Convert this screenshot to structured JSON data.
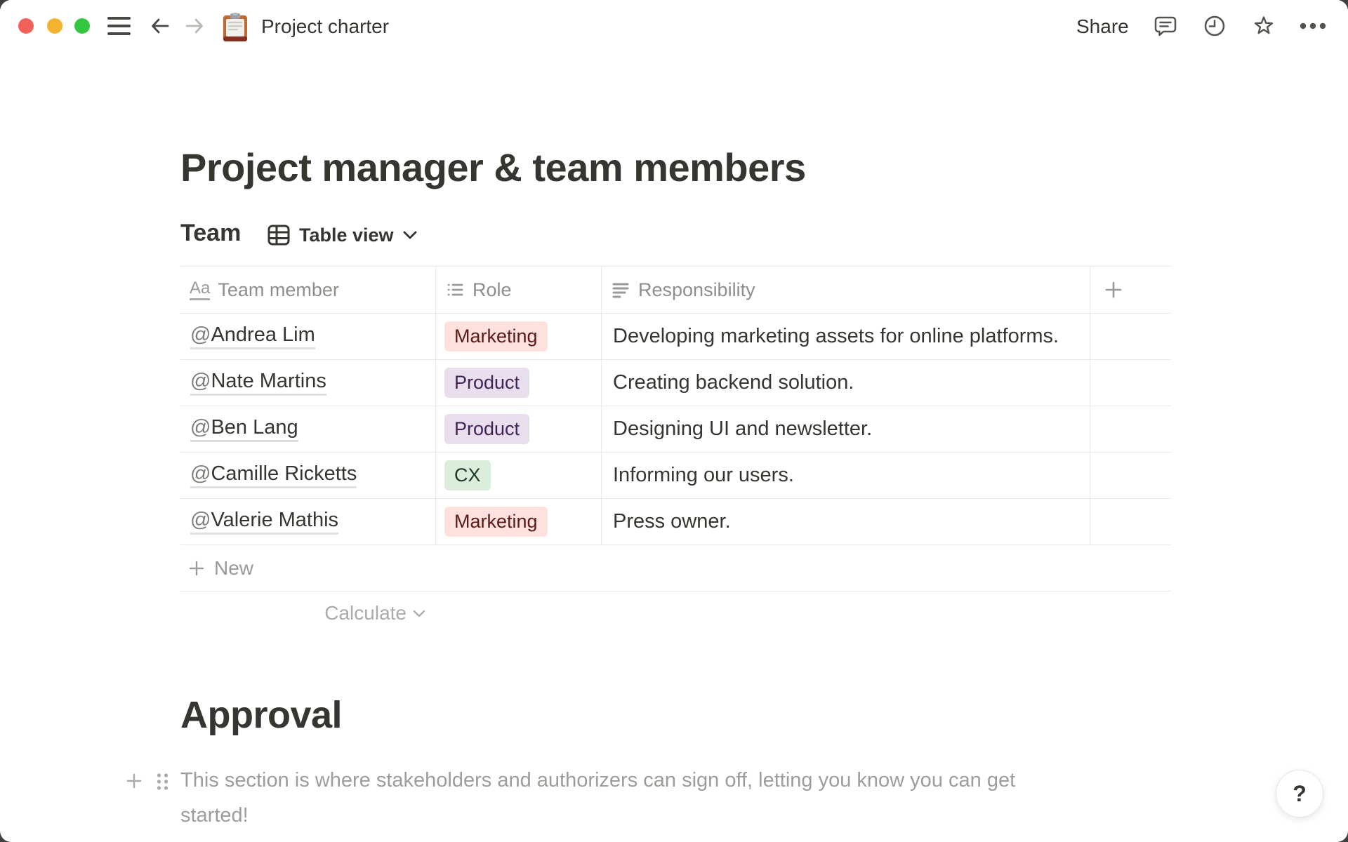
{
  "topbar": {
    "doc_title": "Project charter",
    "share_label": "Share"
  },
  "page": {
    "title": "Project manager & team members"
  },
  "team_section": {
    "heading": "Team",
    "view_label": "Table view",
    "table": {
      "columns": [
        {
          "label": "Team member"
        },
        {
          "label": "Role"
        },
        {
          "label": "Responsibility"
        }
      ],
      "rows": [
        {
          "member": "@Andrea Lim",
          "role": {
            "label": "Marketing",
            "color": "red"
          },
          "responsibility": "Developing marketing assets for online platforms."
        },
        {
          "member": "@Nate Martins",
          "role": {
            "label": "Product",
            "color": "purple"
          },
          "responsibility": "Creating backend solution."
        },
        {
          "member": "@Ben Lang",
          "role": {
            "label": "Product",
            "color": "purple"
          },
          "responsibility": "Designing UI and newsletter."
        },
        {
          "member": "@Camille Ricketts",
          "role": {
            "label": "CX",
            "color": "green"
          },
          "responsibility": "Informing our users."
        },
        {
          "member": "@Valerie Mathis",
          "role": {
            "label": "Marketing",
            "color": "red"
          },
          "responsibility": "Press owner."
        }
      ],
      "new_label": "New",
      "calculate_label": "Calculate"
    }
  },
  "approval_section": {
    "heading": "Approval",
    "paragraph": "This section is where stakeholders and authorizers can sign off, letting you know you can get started!",
    "paragraph_lines": [
      "This section is where stakeholders and authorizers can sign off, letting you know you can get",
      "started!"
    ]
  },
  "help": {
    "label": "?"
  },
  "colors": {
    "tag_red_bg": "#FFE2DD",
    "tag_red_text": "#5D1715",
    "tag_purple_bg": "#E8DEEE",
    "tag_purple_text": "#412454",
    "tag_green_bg": "#DBEDDB",
    "tag_green_text": "#1C3829",
    "border": "#E9E9E7",
    "text": "#37352F",
    "muted": "#8F8E8A"
  }
}
